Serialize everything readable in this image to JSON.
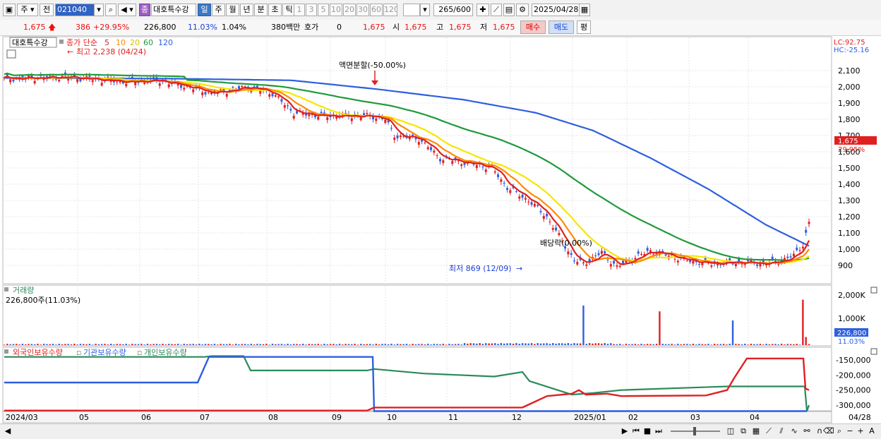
{
  "toolbar": {
    "period_label": "주",
    "jeon_label": "전",
    "code_value": "021040",
    "stock_name": "대호특수강",
    "jong_badge": "종",
    "period_tabs": [
      "일",
      "주",
      "월",
      "년",
      "분",
      "초",
      "틱"
    ],
    "interval_tabs": [
      "1",
      "3",
      "5",
      "10",
      "20",
      "30",
      "60",
      "120"
    ],
    "count_value": "265",
    "count_total": "/600",
    "date_value": "2025/04/28"
  },
  "quote": {
    "price": "1,675",
    "change": "386",
    "change_pct": "+29.95%",
    "volume": "226,800",
    "volume_pct": "11.03%",
    "turnover_pct": "1.04%",
    "amount": "380백만",
    "hoga_label": "호가",
    "hoga_value": "0",
    "ask_price": "1,675",
    "si_label": "시",
    "open": "1,675",
    "go_label": "고",
    "high": "1,675",
    "jeo_label": "저",
    "low": "1,675",
    "buy_label": "매수",
    "sell_label": "매도",
    "pyeong_label": "평"
  },
  "price_panel": {
    "stock_tag": "대호특수강",
    "ma_title": "종가 단순",
    "ma_periods": [
      "5",
      "10",
      "20",
      "60",
      "120"
    ],
    "ma_colors": [
      "#e02020",
      "#ff8a00",
      "#f5e600",
      "#1f9a3a",
      "#2e5fe0"
    ],
    "max_label": "최고 2,238 (04/24)",
    "min_label": "최저 869 (12/09)",
    "split_label": "액면분할(-50.00%)",
    "dividend_label": "배당락(0.00%)",
    "lc_label": "LC:92.75",
    "hc_label": "HC:-25.16",
    "current_price_label": "1,675",
    "current_pct_label": "29.95%",
    "price_ticks": [
      "2,100",
      "2,000",
      "1,900",
      "1,800",
      "1,700",
      "1,600",
      "1,500",
      "1,400",
      "1,300",
      "1,200",
      "1,100",
      "1,000",
      "900"
    ]
  },
  "volume_panel": {
    "title": "거래량",
    "value_label": "226,800주(11.03%)",
    "ticks": [
      "2,000K",
      "1,000K"
    ],
    "current_label": "226,800",
    "current_pct": "11.03%"
  },
  "holding_panel": {
    "legend": [
      "외국인보유수량",
      "기관보유수량",
      "개인보유수량"
    ],
    "legend_colors": [
      "#e02020",
      "#2e5fe0",
      "#2a8a5a"
    ],
    "ticks": [
      "-150,000",
      "-200,000",
      "-250,000",
      "-300,000"
    ]
  },
  "date_axis": [
    "2024/03",
    "05",
    "06",
    "07",
    "08",
    "09",
    "10",
    "11",
    "12",
    "2025/01",
    "02",
    "03",
    "04",
    "04/28"
  ],
  "chart_data": {
    "type": "line",
    "title": "",
    "x": [
      "2024/03",
      "2024/04",
      "2024/05",
      "2024/06",
      "2024/07",
      "2024/08",
      "2024/09",
      "2024/10",
      "2024/11",
      "2024/12",
      "2025/01",
      "2025/02",
      "2025/03",
      "2025/04",
      "2025/04/28"
    ],
    "series": [
      {
        "name": "5",
        "values": [
          2040,
          2060,
          2020,
          2030,
          2000,
          1880,
          1820,
          1780,
          1500,
          1050,
          930,
          920,
          920,
          1000,
          1160
        ]
      },
      {
        "name": "120",
        "values": [
          2060,
          2060,
          2060,
          2060,
          2050,
          2040,
          2010,
          1940,
          1860,
          1760,
          1570,
          1410,
          1230,
          1060,
          1020
        ]
      }
    ],
    "ylim": [
      860,
      2180
    ],
    "annotations": [
      "최고 2,238 (04/24)",
      "최저 869 (12/09)",
      "액면분할(-50.00%)",
      "배당락(0.00%)"
    ]
  },
  "scroll": {
    "icons": [
      "play-icon",
      "first-icon",
      "stop-icon",
      "last-icon"
    ]
  }
}
